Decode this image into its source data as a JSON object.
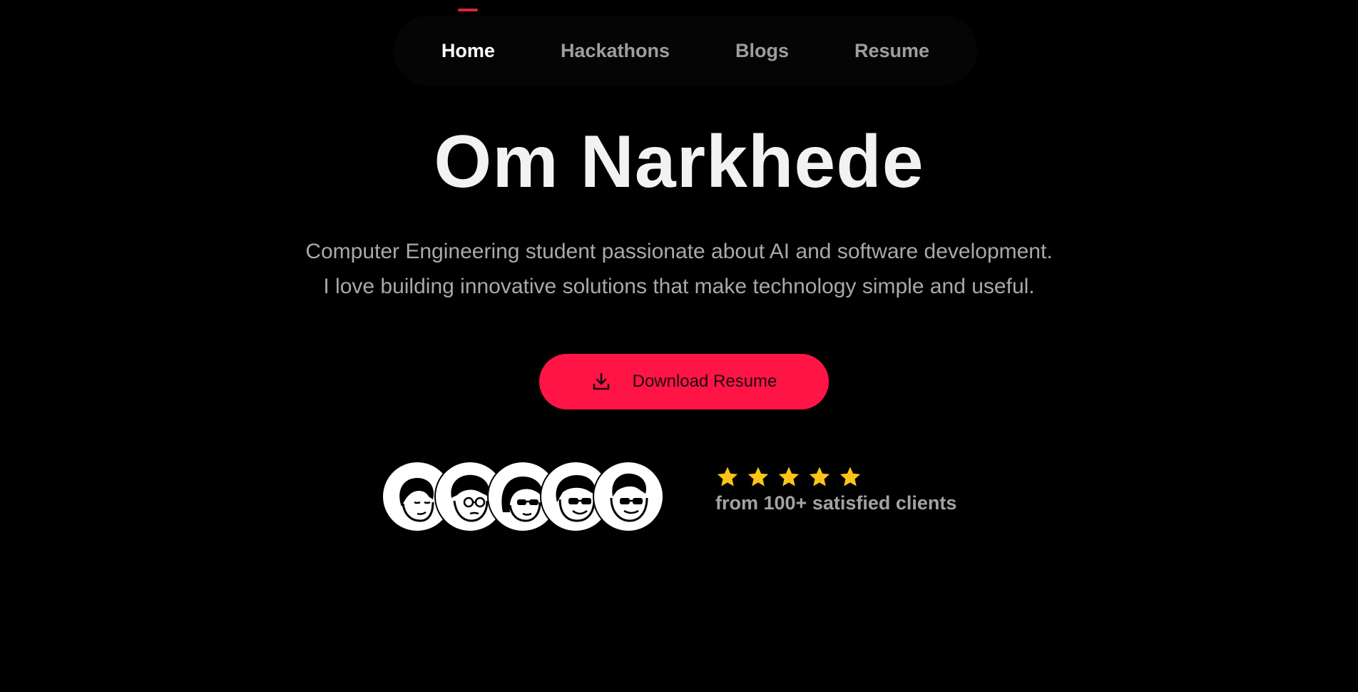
{
  "nav": {
    "items": [
      {
        "label": "Home",
        "active": true
      },
      {
        "label": "Hackathons",
        "active": false
      },
      {
        "label": "Blogs",
        "active": false
      },
      {
        "label": "Resume",
        "active": false
      }
    ],
    "indicator_color": "#e0243a"
  },
  "hero": {
    "title": "Om Narkhede",
    "subtitle_line1": "Computer Engineering student passionate about AI and software development.",
    "subtitle_line2": "I love building innovative solutions that make technology simple and useful."
  },
  "cta": {
    "label": "Download Resume",
    "icon": "download-icon",
    "color": "#ff1446"
  },
  "social_proof": {
    "avatar_count": 5,
    "avatar_icons": [
      "avatar-face-closed-eyes",
      "avatar-face-glasses",
      "avatar-face-sunglasses",
      "avatar-face-sunglasses-smile",
      "avatar-face-sunglasses-grin"
    ],
    "rating": 5,
    "rating_max": 5,
    "star_color": "#fcc419",
    "text": "from 100+ satisfied clients"
  }
}
